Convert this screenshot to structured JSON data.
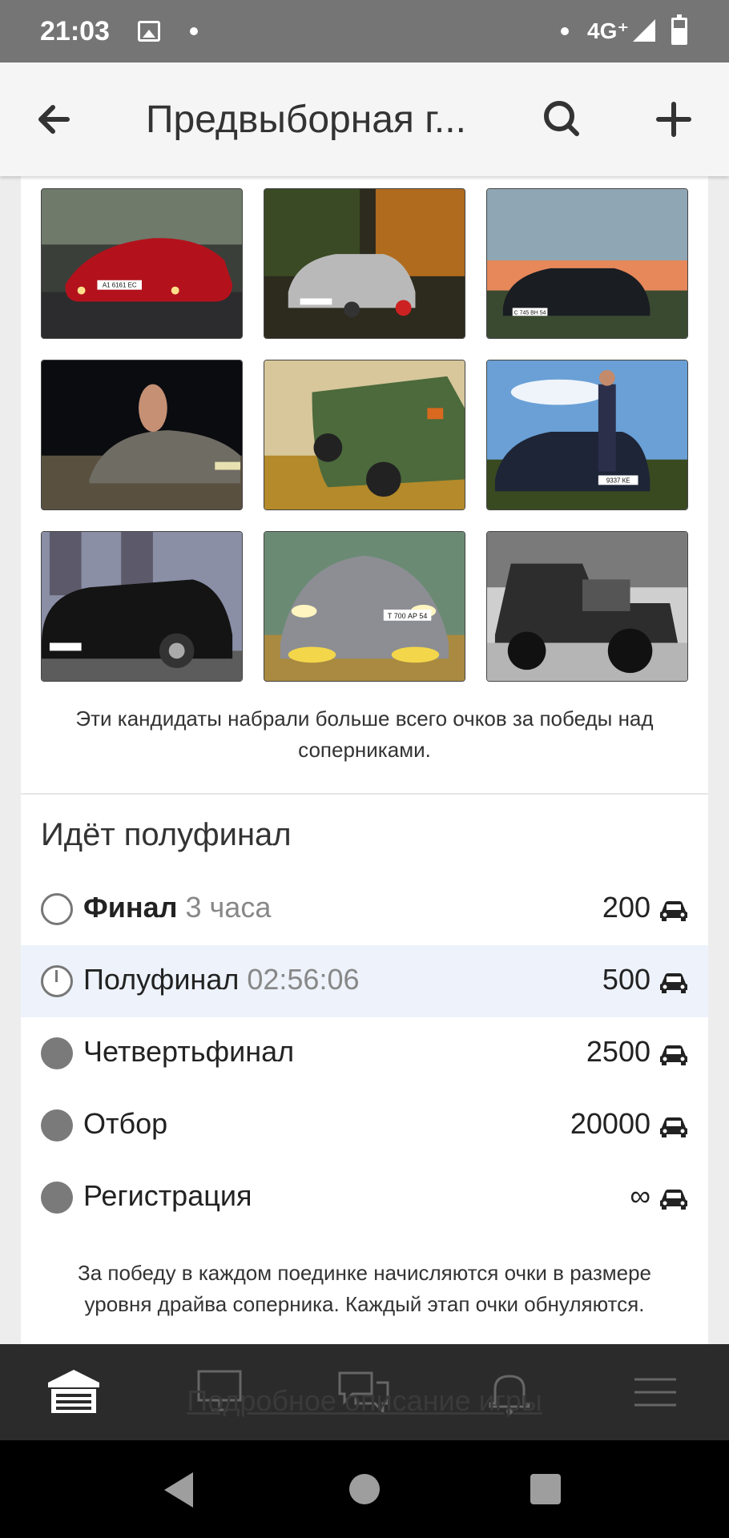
{
  "status_bar": {
    "time": "21:03",
    "network": "4G⁺",
    "icons": [
      "image-icon",
      "dot-icon",
      "dot-icon",
      "signal-icon",
      "battery-icon"
    ]
  },
  "toolbar": {
    "title": "Предвыборная г...",
    "back_icon": "arrow-left-icon",
    "search_icon": "search-icon",
    "add_icon": "plus-icon"
  },
  "photos": [
    {
      "plate": "А1 6161 ЕС",
      "scene": "red sports car at dusk"
    },
    {
      "plate": "",
      "scene": "silver hatchback in autumn forest"
    },
    {
      "plate": "С 745 ВН 54",
      "scene": "black hatchback at sunset"
    },
    {
      "plate": "",
      "scene": "car at night with person"
    },
    {
      "plate": "",
      "scene": "green sedan in autumn leaves"
    },
    {
      "plate": "9337 КЕ",
      "scene": "dark sedan with person under blue sky"
    },
    {
      "plate": "",
      "scene": "black classic sedan by building"
    },
    {
      "plate": "Т 700 АР 54",
      "scene": "silver sedan with yellow fog lights"
    },
    {
      "plate": "",
      "scene": "black and white hot rod"
    }
  ],
  "caption": "Эти кандидаты набрали больше всего очков за победы над соперниками.",
  "section_title": "Идёт полуфинал",
  "stages": [
    {
      "name": "Финал",
      "time": "3 часа",
      "count": "200",
      "status": "upcoming"
    },
    {
      "name": "Полуфинал",
      "time": "02:56:06",
      "count": "500",
      "status": "current"
    },
    {
      "name": "Четвертьфинал",
      "time": "",
      "count": "2500",
      "status": "done"
    },
    {
      "name": "Отбор",
      "time": "",
      "count": "20000",
      "status": "done"
    },
    {
      "name": "Регистрация",
      "time": "",
      "count": "∞",
      "status": "done"
    }
  ],
  "footnote": "За победу в каждом поединке начисляются очки в размере уровня драйва соперника. Каждый этап очки обнуляются.",
  "hidden_link": "Подробное описание игры",
  "bottom_nav": [
    "garage-icon",
    "monitor-icon",
    "chat-icon",
    "bell-icon",
    "menu-icon"
  ],
  "colors": {
    "current_row": "#edf2fb",
    "nav_bg": "#2b2b2b",
    "status_bar": "#757575"
  }
}
